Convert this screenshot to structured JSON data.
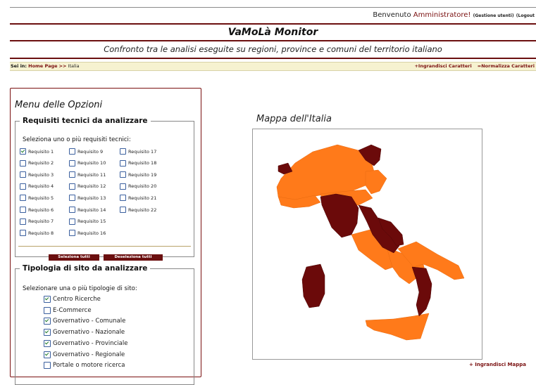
{
  "header": {
    "welcome_prefix": "Benvenuto",
    "user": "Amministratore!",
    "user_manage": "(Gestione utenti)",
    "logout": "(Logout"
  },
  "app": {
    "title": "VaMoLà Monitor",
    "subtitle": "Confronto tra le analisi eseguite su regioni, province e comuni del territorio italiano"
  },
  "breadcrumb": {
    "label": "Sei in:",
    "home": "Home Page",
    "separator": ">>",
    "current": "Italia",
    "enlarge_chars": "+Ingrandisci Caratteri",
    "normalize_chars": "=Normalizza Caratteri"
  },
  "menu": {
    "title": "Menu delle Opzioni",
    "requirements": {
      "legend": "Requisiti tecnici da analizzare",
      "hint": "Seleziona uno o più requisiti tecnici:",
      "items": [
        {
          "label": "Requisito 1",
          "checked": true
        },
        {
          "label": "Requisito 2",
          "checked": false
        },
        {
          "label": "Requisito 3",
          "checked": false
        },
        {
          "label": "Requisito 4",
          "checked": false
        },
        {
          "label": "Requisito 5",
          "checked": false
        },
        {
          "label": "Requisito 6",
          "checked": false
        },
        {
          "label": "Requisito 7",
          "checked": false
        },
        {
          "label": "Requisito 8",
          "checked": false
        },
        {
          "label": "Requisito 9",
          "checked": false
        },
        {
          "label": "Requisito 10",
          "checked": false
        },
        {
          "label": "Requisito 11",
          "checked": false
        },
        {
          "label": "Requisito 12",
          "checked": false
        },
        {
          "label": "Requisito 13",
          "checked": false
        },
        {
          "label": "Requisito 14",
          "checked": false
        },
        {
          "label": "Requisito 15",
          "checked": false
        },
        {
          "label": "Requisito 16",
          "checked": false
        },
        {
          "label": "Requisito 17",
          "checked": false
        },
        {
          "label": "Requisito 18",
          "checked": false
        },
        {
          "label": "Requisito 19",
          "checked": false
        },
        {
          "label": "Requisito 20",
          "checked": false
        },
        {
          "label": "Requisito 21",
          "checked": false
        },
        {
          "label": "Requisito 22",
          "checked": false
        }
      ],
      "select_all": "Seleziona tutti",
      "deselect_all": "Deseleziona tutti"
    },
    "site_types": {
      "legend": "Tipologia di sito da analizzare",
      "hint": "Selezionare una o più tipologie di sito:",
      "items": [
        {
          "label": "Centro Ricerche",
          "checked": true
        },
        {
          "label": "E-Commerce",
          "checked": false
        },
        {
          "label": "Governativo - Comunale",
          "checked": true
        },
        {
          "label": "Governativo - Nazionale",
          "checked": true
        },
        {
          "label": "Governativo - Provinciale",
          "checked": true
        },
        {
          "label": "Governativo - Regionale",
          "checked": true
        },
        {
          "label": "Portale o motore ricerca",
          "checked": false
        }
      ]
    }
  },
  "map": {
    "title": "Mappa dell'Italia",
    "enlarge": "+ Ingrandisci Mappa",
    "colors": {
      "orange": "#ff7a1a",
      "dark": "#6b0a0a"
    }
  }
}
